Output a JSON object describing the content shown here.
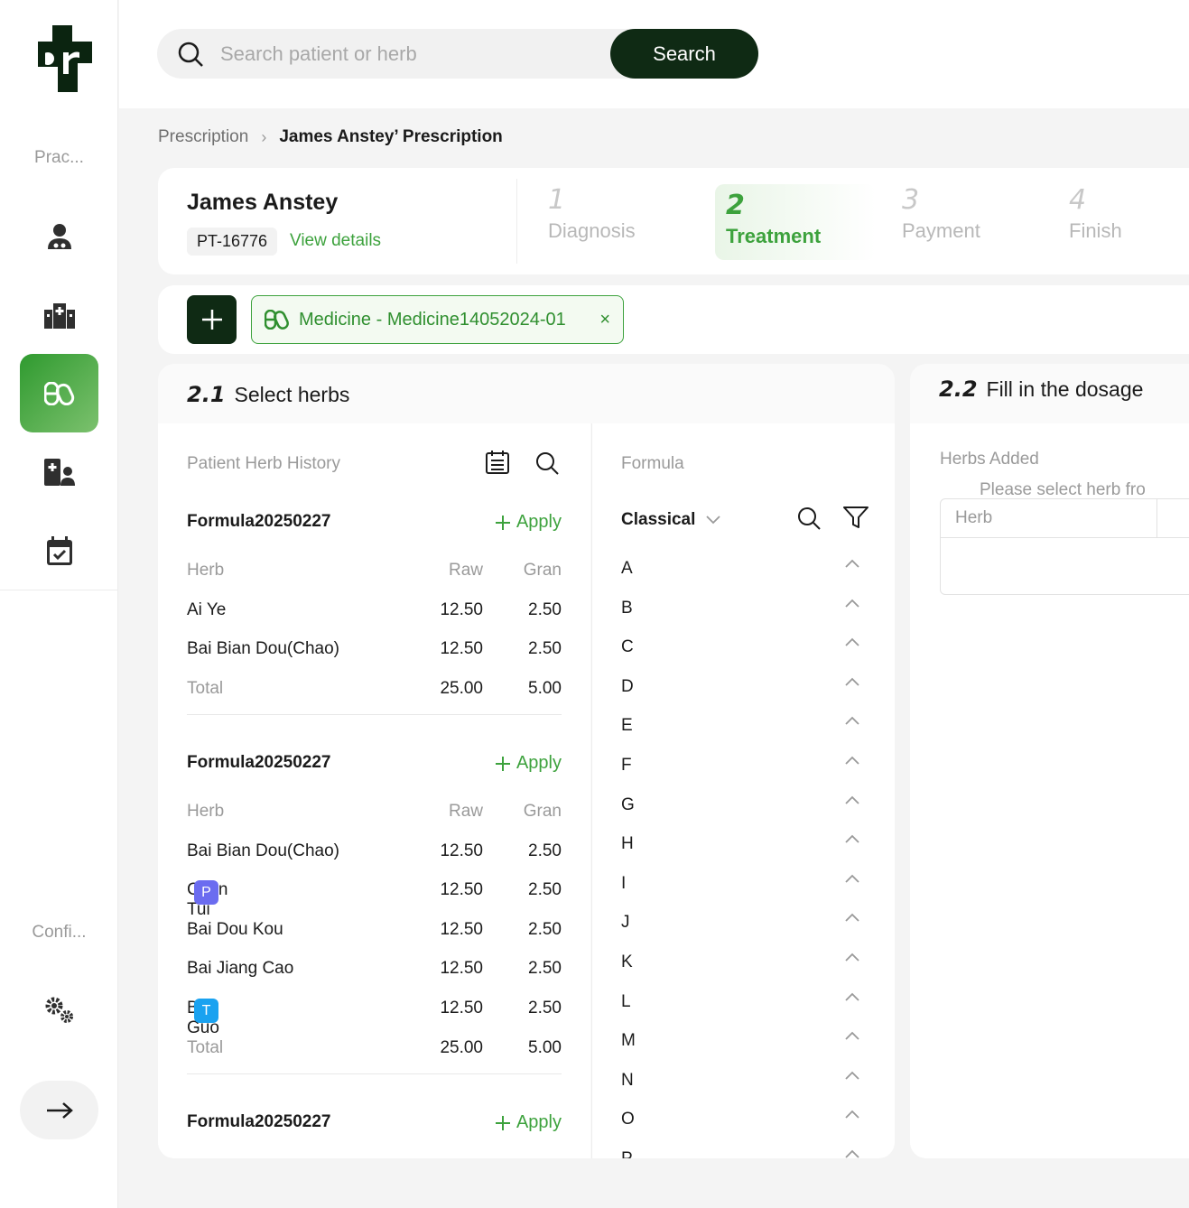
{
  "sidebar": {
    "practice_label": "Prac...",
    "config_label": "Confi...",
    "items": [
      {
        "icon": "patient-icon"
      },
      {
        "icon": "clinic-icon"
      },
      {
        "icon": "medicine-icon",
        "active": true
      },
      {
        "icon": "staff-icon"
      },
      {
        "icon": "calendar-icon"
      }
    ]
  },
  "search": {
    "placeholder": "Search patient or herb",
    "button_label": "Search"
  },
  "breadcrumb": {
    "parent": "Prescription",
    "current": "James Anstey’ Prescription"
  },
  "patient": {
    "name": "James Anstey",
    "id": "PT-16776",
    "details_link": "View details"
  },
  "steps": [
    {
      "num": "1",
      "label": "Diagnosis"
    },
    {
      "num": "2",
      "label": "Treatment",
      "active": true
    },
    {
      "num": "3",
      "label": "Payment"
    },
    {
      "num": "4",
      "label": "Finish"
    }
  ],
  "medicine_tag": {
    "label": "Medicine - Medicine14052024-01",
    "close": "×"
  },
  "select_herbs": {
    "num": "2.1",
    "title": "Select herbs",
    "history_label": "Patient Herb History",
    "formulas": [
      {
        "name": "Formula20250227",
        "apply": "Apply",
        "headers": {
          "herb": "Herb",
          "raw": "Raw",
          "gran": "Gran"
        },
        "rows": [
          {
            "herb": "Ai Ye",
            "raw": "12.50",
            "gran": "2.50",
            "badge": ""
          },
          {
            "herb": "Bai Bian Dou(Chao)",
            "raw": "12.50",
            "gran": "2.50",
            "badge": ""
          }
        ],
        "total": {
          "label": "Total",
          "raw": "25.00",
          "gran": "5.00"
        }
      },
      {
        "name": "Formula20250227",
        "apply": "Apply",
        "headers": {
          "herb": "Herb",
          "raw": "Raw",
          "gran": "Gran"
        },
        "rows": [
          {
            "herb": "Bai Bian Dou(Chao)",
            "raw": "12.50",
            "gran": "2.50",
            "badge": ""
          },
          {
            "herb": "Chan Tui",
            "raw": "12.50",
            "gran": "2.50",
            "badge": "P"
          },
          {
            "herb": "Bai Dou Kou",
            "raw": "12.50",
            "gran": "2.50",
            "badge": ""
          },
          {
            "herb": "Bai Jiang Cao",
            "raw": "12.50",
            "gran": "2.50",
            "badge": ""
          },
          {
            "herb": "Bai Guo",
            "raw": "12.50",
            "gran": "2.50",
            "badge": "T"
          }
        ],
        "total": {
          "label": "Total",
          "raw": "25.00",
          "gran": "5.00"
        }
      },
      {
        "name": "Formula20250227",
        "apply": "Apply"
      }
    ],
    "formula_label": "Formula",
    "formula_type": "Classical",
    "letters": [
      "A",
      "B",
      "C",
      "D",
      "E",
      "F",
      "G",
      "H",
      "I",
      "J",
      "K",
      "L",
      "M",
      "N",
      "O",
      "P"
    ]
  },
  "dosage": {
    "num": "2.2",
    "title": "Fill in the dosage",
    "added_label": "Herbs Added",
    "table_header": "Herb",
    "empty_message": "Please select herb fro"
  }
}
